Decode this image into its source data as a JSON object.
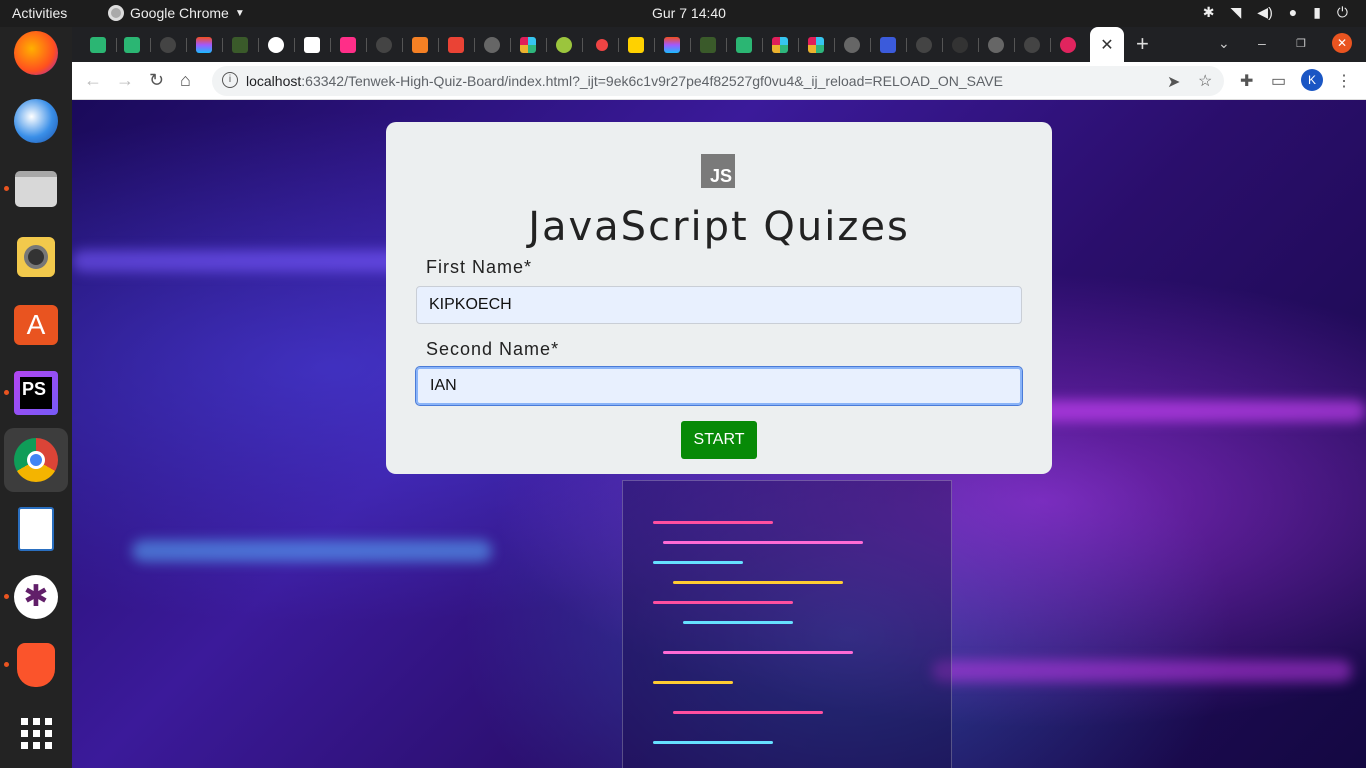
{
  "system": {
    "activities": "Activities",
    "app_name": "Google Chrome",
    "clock": "Gur 7  14:40"
  },
  "browser": {
    "url_host": "localhost",
    "url_rest": ":63342/Tenwek-High-Quiz-Board/index.html?_ijt=9ek6c1v9r27pe4f82527gf0vu4&_ij_reload=RELOAD_ON_SAVE",
    "profile_initial": "K"
  },
  "quiz": {
    "logo_text": "JS",
    "title": "JavaScript Quizes",
    "first_name_label": "First Name*",
    "first_name_value": "KIPKOECH",
    "second_name_label": "Second Name*",
    "second_name_value": "IAN",
    "start_label": "START"
  },
  "colors": {
    "start_button": "#078a07",
    "card_bg": "#eceff0",
    "input_bg": "#e8f0fe"
  }
}
